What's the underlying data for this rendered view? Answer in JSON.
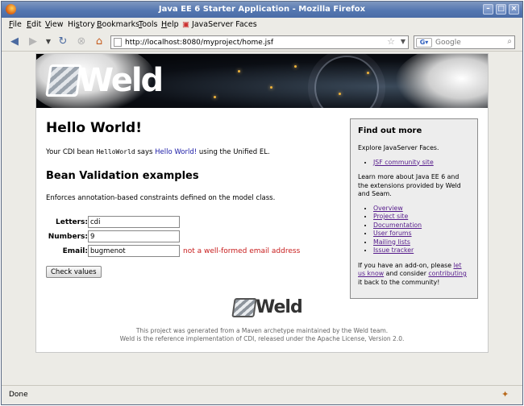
{
  "window": {
    "title": "Java EE 6 Starter Application - Mozilla Firefox"
  },
  "menu": {
    "items": [
      {
        "label": "File",
        "accel": "F"
      },
      {
        "label": "Edit",
        "accel": "E"
      },
      {
        "label": "View",
        "accel": "V"
      },
      {
        "label": "History",
        "accel": "s"
      },
      {
        "label": "Bookmarks",
        "accel": "B"
      },
      {
        "label": "Tools",
        "accel": "T"
      },
      {
        "label": "Help",
        "accel": "H"
      }
    ],
    "bookmark_label": "JavaServer Faces"
  },
  "nav": {
    "url": "http://localhost:8080/myproject/home.jsf",
    "search_placeholder": "Google",
    "search_engine_icon": "google-icon"
  },
  "banner": {
    "logo_text": "Weld"
  },
  "main": {
    "heading": "Hello World!",
    "intro_prefix": "Your CDI bean",
    "intro_bean": "HelloWorld",
    "intro_says": "says",
    "intro_link": "Hello World!",
    "intro_suffix": "using the Unified EL.",
    "section_heading": "Bean Validation examples",
    "section_desc": "Enforces annotation-based constraints defined on the model class.",
    "form": {
      "letters_label": "Letters:",
      "letters_value": "cdi",
      "numbers_label": "Numbers:",
      "numbers_value": "9",
      "email_label": "Email:",
      "email_value": "bugmenot",
      "email_error": "not a well-formed email address",
      "submit_label": "Check values"
    }
  },
  "sidebar": {
    "heading": "Find out more",
    "jsf_text": "Explore JavaServer Faces.",
    "jsf_link": "JSF community site",
    "javaee_text": "Learn more about Java EE 6 and the extensions provided by Weld and Seam.",
    "links": [
      "Overview",
      "Project site",
      "Documentation",
      "User forums",
      "Mailing lists",
      "Issue tracker"
    ],
    "addon_prefix": "If you have an add-on, please",
    "addon_link1": "let us know",
    "addon_mid": "and consider",
    "addon_link2": "contributing",
    "addon_suffix": "it back to the community!"
  },
  "footer": {
    "logo_text": "Weld",
    "line1": "This project was generated from a Maven archetype maintained by the Weld team.",
    "line2": "Weld is the reference implementation of CDI, released under the Apache License, Version 2.0."
  },
  "status": {
    "text": "Done"
  },
  "colors": {
    "titlebar": "#5477b1",
    "link": "#1a1aa6",
    "visited": "#551a8b",
    "error": "#c81d1d"
  }
}
